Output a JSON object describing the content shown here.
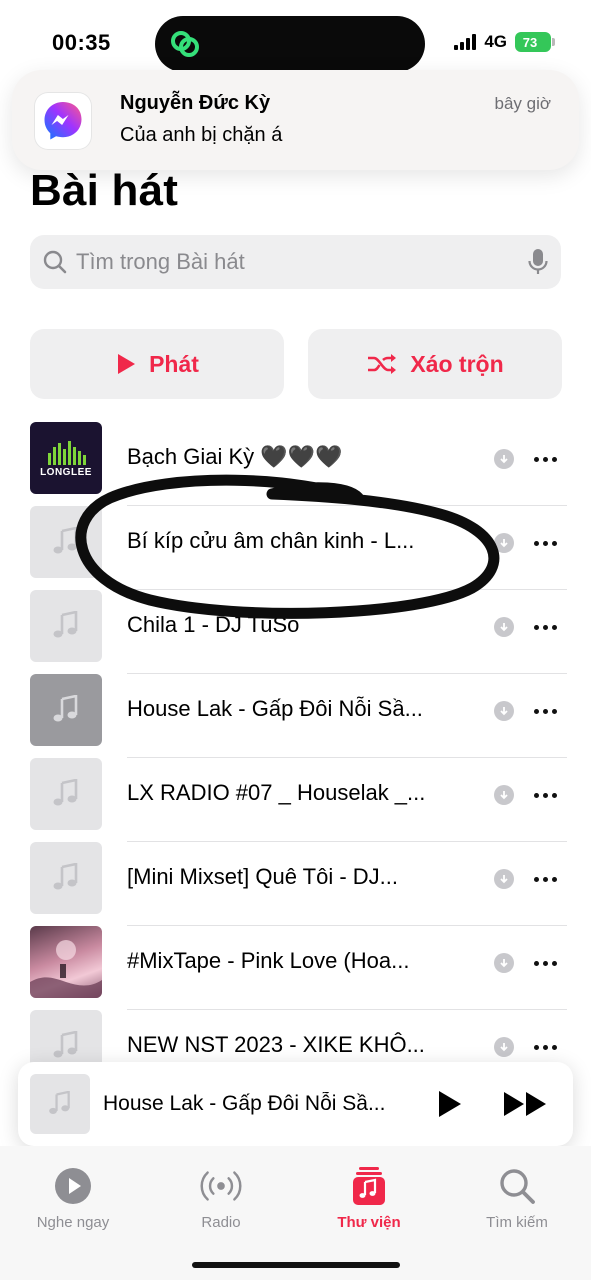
{
  "status_bar": {
    "time": "00:35",
    "network": "4G",
    "battery": "73"
  },
  "notification": {
    "app": "Messenger",
    "sender": "Nguyễn Đức Kỳ",
    "message": "Của anh bị chặn á",
    "time": "bây giờ"
  },
  "page": {
    "title": "Bài hát"
  },
  "search": {
    "placeholder": "Tìm trong Bài hát"
  },
  "actions": {
    "play_label": "Phát",
    "shuffle_label": "Xáo trộn"
  },
  "songs": [
    {
      "title": "Bạch Giai Kỳ 🖤🖤🖤",
      "artwork": "longlee-logo"
    },
    {
      "title": "Bí kíp cửu âm chân kinh - L...",
      "artwork": "music-note-icon"
    },
    {
      "title": "Chila 1 - DJ TuSo",
      "artwork": "music-note-icon"
    },
    {
      "title": "House Lak - Gấp Đôi Nỗi Sầ...",
      "artwork": "gray-artwork"
    },
    {
      "title": "LX RADIO #07 _ Houselak _...",
      "artwork": "music-note-icon"
    },
    {
      "title": "[Mini Mixset] Quê Tôi  - DJ...",
      "artwork": "music-note-icon"
    },
    {
      "title": "#MixTape - Pink Love (Hoa...",
      "artwork": "pink-artwork"
    },
    {
      "title": "NEW NST 2023 - XIKE KHÔ...",
      "artwork": "music-note-icon"
    }
  ],
  "artwork_text": {
    "longlee": "LONGLEE"
  },
  "now_playing": {
    "title": "House Lak - Gấp Đôi Nỗi Sầ..."
  },
  "tabs": [
    {
      "label": "Nghe ngay",
      "icon": "play-circle-icon",
      "active": false
    },
    {
      "label": "Radio",
      "icon": "radio-icon",
      "active": false
    },
    {
      "label": "Thư viện",
      "icon": "library-icon",
      "active": true
    },
    {
      "label": "Tìm kiếm",
      "icon": "search-icon",
      "active": false
    }
  ],
  "colors": {
    "accent": "#f0284a",
    "battery": "#34c759"
  }
}
